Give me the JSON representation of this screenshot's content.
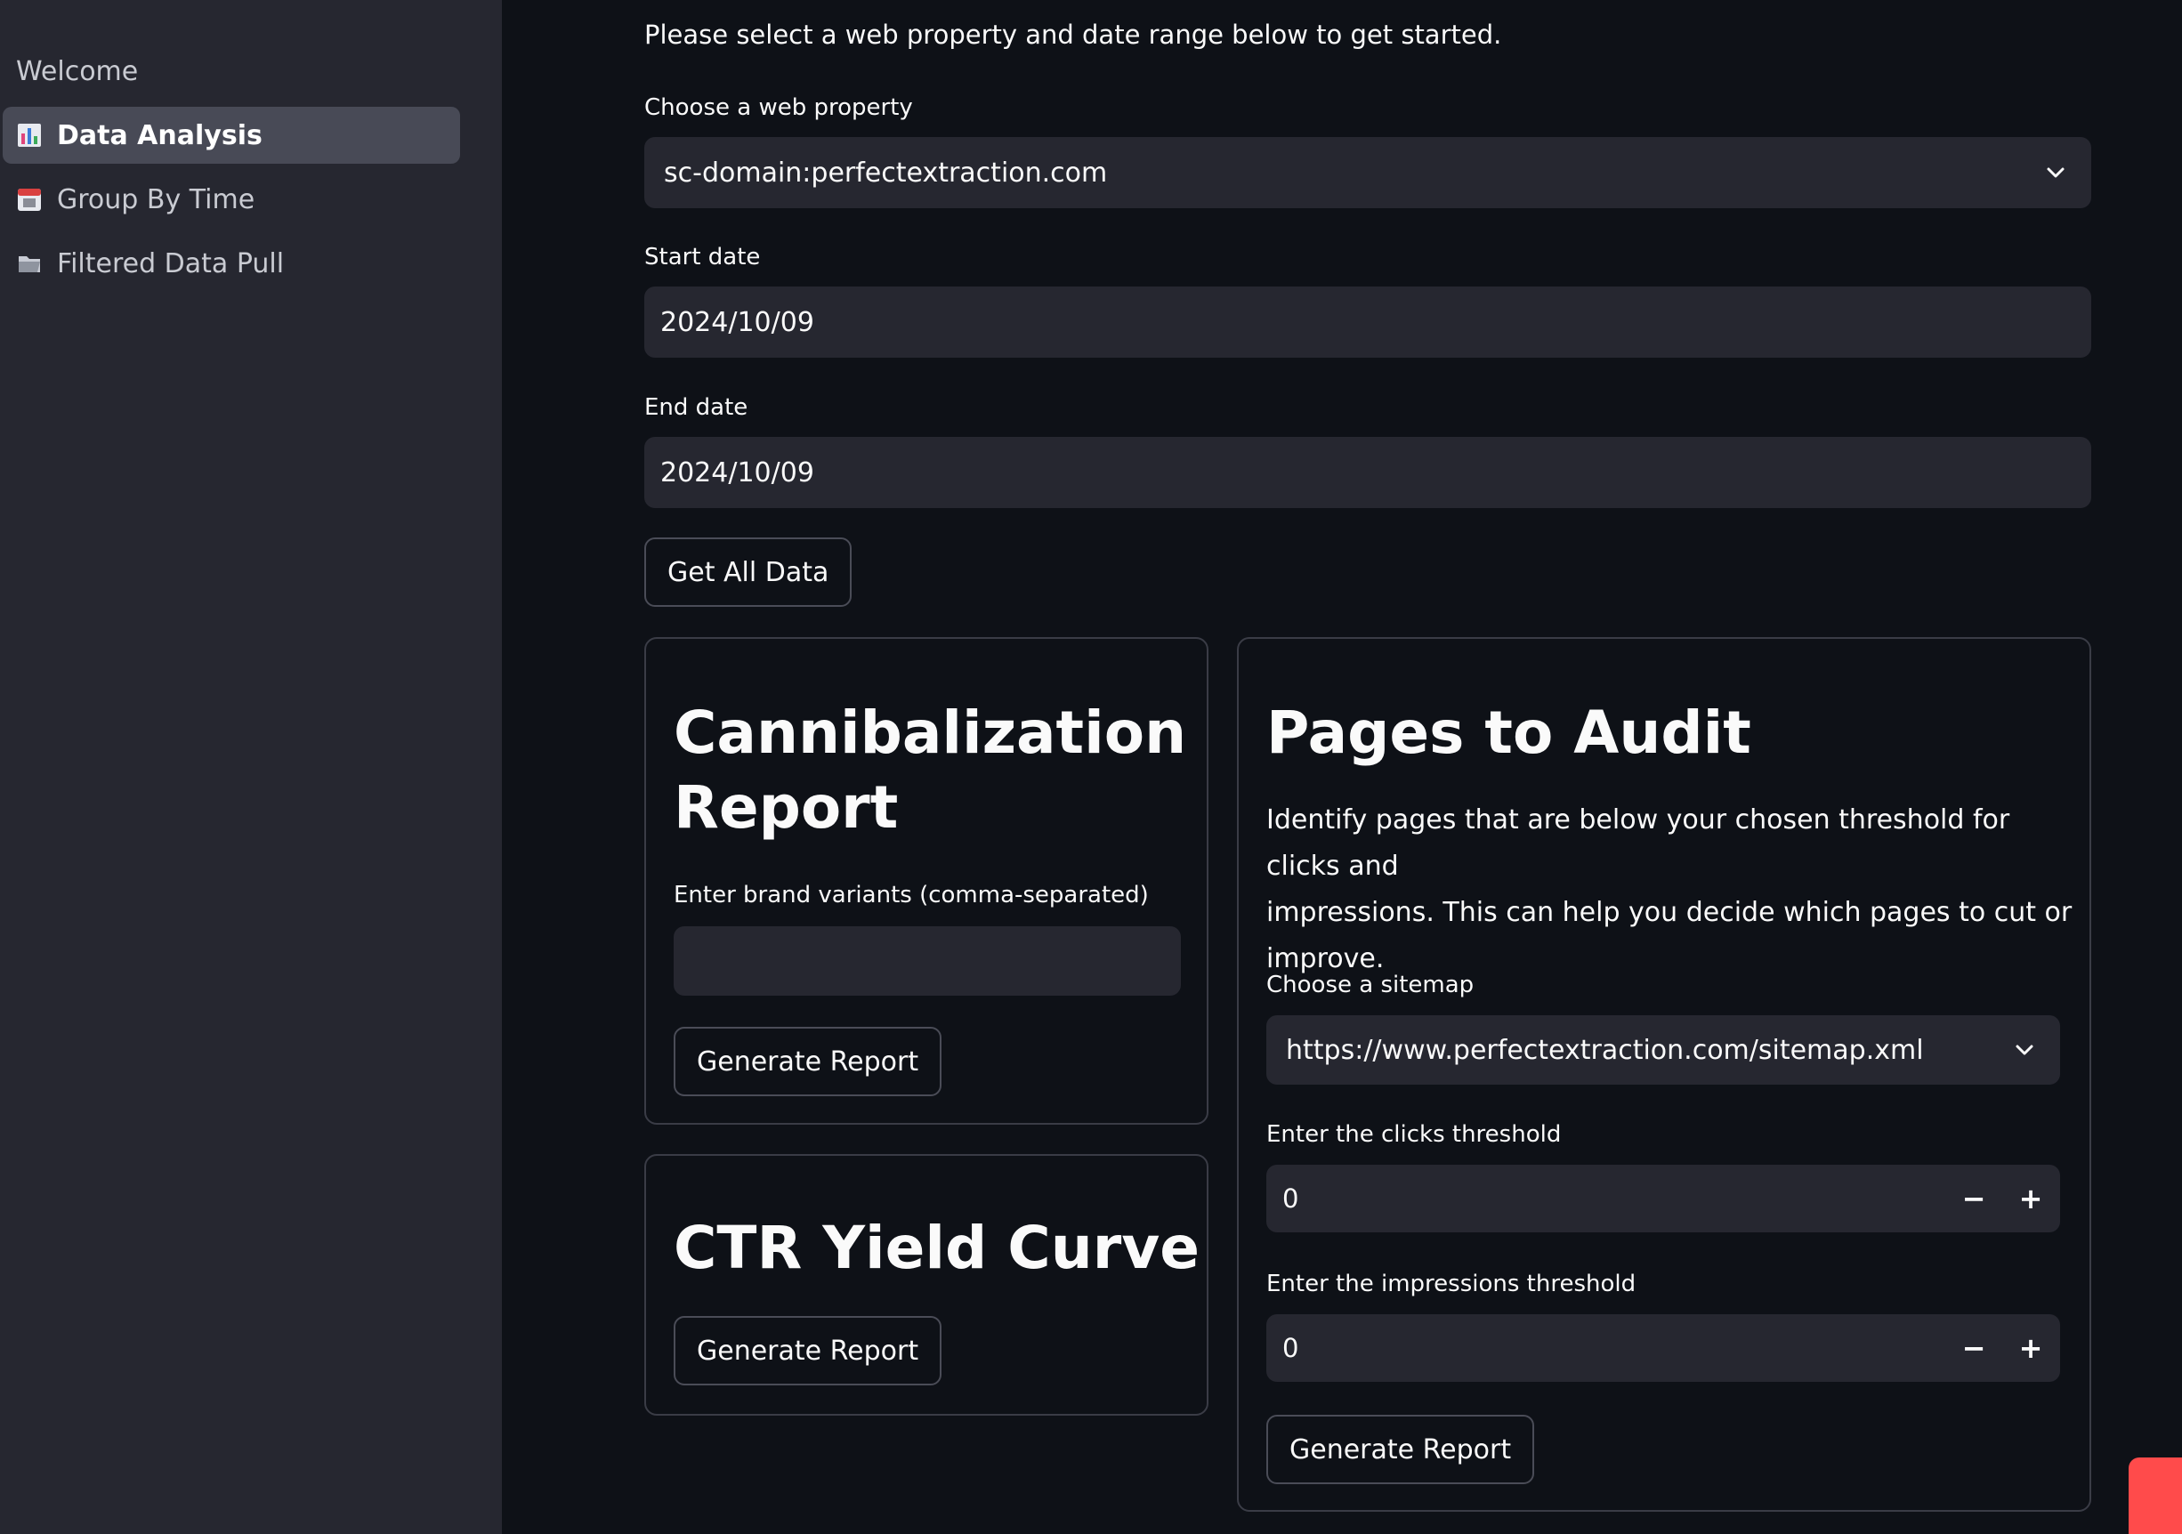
{
  "sidebar": {
    "items": [
      {
        "label": "Welcome",
        "icon": "none"
      },
      {
        "label": "Data Analysis",
        "icon": "bar-chart-icon",
        "active": true
      },
      {
        "label": "Group By Time",
        "icon": "calendar-icon"
      },
      {
        "label": "Filtered Data Pull",
        "icon": "folder-icon"
      }
    ]
  },
  "main": {
    "intro": "Please select a web property and date range below to get started.",
    "property": {
      "label": "Choose a web property",
      "value": "sc-domain:perfectextraction.com"
    },
    "start_date": {
      "label": "Start date",
      "value": "2024/10/09"
    },
    "end_date": {
      "label": "End date",
      "value": "2024/10/09"
    },
    "get_all_label": "Get All Data"
  },
  "cannibalization": {
    "title_line1": "Cannibalization",
    "title_line2": "Report",
    "input_label": "Enter brand variants (comma-separated)",
    "input_value": "",
    "button_label": "Generate Report"
  },
  "ctr": {
    "title": "CTR Yield Curve",
    "button_label": "Generate Report"
  },
  "audit": {
    "title": "Pages to Audit",
    "description_line1": "Identify pages that are below your chosen threshold for clicks and",
    "description_line2": "impressions. This can help you decide which pages to cut or",
    "description_line3": "improve.",
    "sitemap_label": "Choose a sitemap",
    "sitemap_value": "https://www.perfectextraction.com/sitemap.xml",
    "clicks_label": "Enter the clicks threshold",
    "clicks_value": "0",
    "impressions_label": "Enter the impressions threshold",
    "impressions_value": "0",
    "minus_symbol": "−",
    "plus_symbol": "+",
    "button_label": "Generate Report"
  },
  "colors": {
    "background": "#0e1117",
    "sidebar": "#262730",
    "input": "#262730",
    "active_nav": "#484a56",
    "accent": "#ff4b4b"
  }
}
